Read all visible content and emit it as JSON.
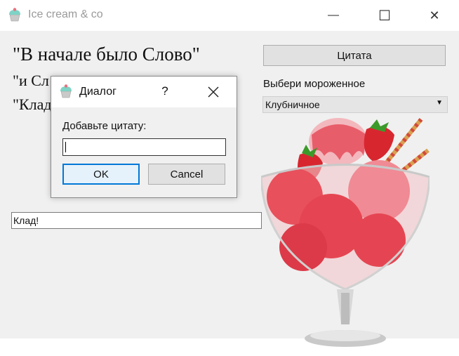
{
  "window": {
    "title": "Ice cream & co",
    "minimize_glyph": "—",
    "maximize_glyph": "☐",
    "close_glyph": "✕"
  },
  "main": {
    "line1": "\"В начале было Слово\"",
    "line2": "\"и Сл",
    "line3": "\"Клад",
    "quote_button": "Цитата",
    "select_label": "Выбери мороженное",
    "select_value": "Клубничное",
    "text_field_value": "Клад!"
  },
  "dialog": {
    "title": "Диалог",
    "help": "?",
    "label": "Добавьте цитату:",
    "input_value": "",
    "ok_label": "OK",
    "cancel_label": "Cancel"
  },
  "colors": {
    "accent": "#0078d7",
    "client_bg": "#f0f0f0"
  }
}
